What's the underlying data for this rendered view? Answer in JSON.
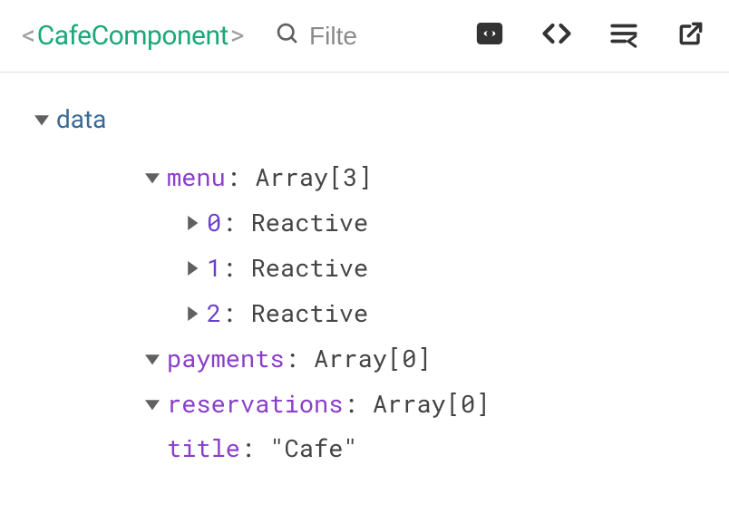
{
  "header": {
    "title": "CafeComponent",
    "angleLeft": "<",
    "angleRight": ">",
    "filterPlaceholder": "Filte",
    "icons": {
      "search": "search-icon",
      "inspect": "eye-box-icon",
      "code": "angle-brackets-icon",
      "format": "format-lines-icon",
      "open": "open-external-icon"
    }
  },
  "tree": {
    "root": {
      "label": "data"
    },
    "menu": {
      "key": "menu",
      "type": "Array[3]",
      "items": [
        {
          "index": "0",
          "value": "Reactive"
        },
        {
          "index": "1",
          "value": "Reactive"
        },
        {
          "index": "2",
          "value": "Reactive"
        }
      ]
    },
    "payments": {
      "key": "payments",
      "type": "Array[0]"
    },
    "reservations": {
      "key": "reservations",
      "type": "Array[0]"
    },
    "title": {
      "key": "title",
      "value": "\"Cafe\""
    },
    "colon": ": "
  }
}
